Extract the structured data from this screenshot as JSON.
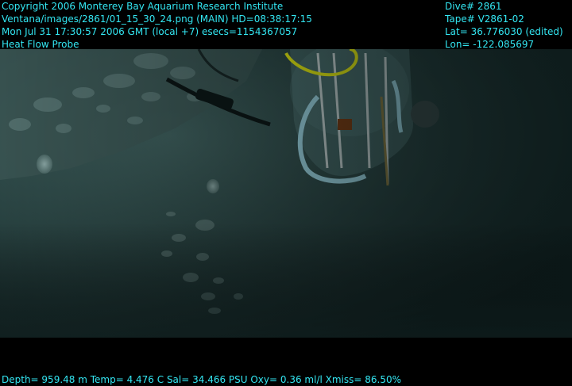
{
  "header_left": [
    "Copyright 2006 Monterey Bay Aquarium Research Institute",
    "Ventana/images/2861/01_15_30_24.png (MAIN)  HD=08:38:17:15",
    "Mon Jul 31 17:30:57 2006 GMT (local +7)  esecs=1154367057",
    "Heat Flow Probe"
  ],
  "header_right": [
    "Dive# 2861",
    "Tape# V2861-02",
    "Lat= 36.776030 (edited)",
    "Lon= -122.085697"
  ],
  "footer": "Depth= 959.48 m  Temp= 4.476 C  Sal= 34.466 PSU  Oxy= 0.36 ml/l  Xmiss= 86.50%",
  "colors": {
    "overlay_text": "#33e6f2",
    "water": "#1e3b3b",
    "sediment": "#2a4040",
    "probe_tube": "#9fd8e6",
    "yellow_line": "#e8ee10"
  }
}
